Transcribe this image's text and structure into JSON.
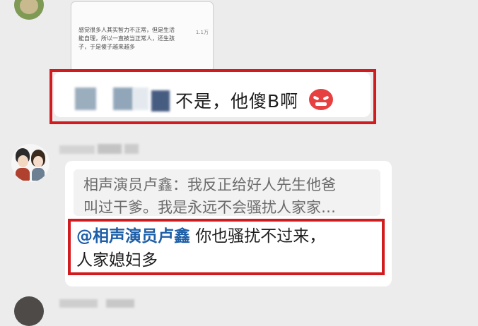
{
  "image_card": {
    "lines": [
      "感觉很多人其实智力不正常，但是生活",
      "能自理，所以一直被当正常人，还生孩",
      "子，于是傻子越来越多"
    ],
    "meta": "1.1万"
  },
  "message_1": {
    "text": "不是，他傻B啊",
    "emoji": "angry-face-icon"
  },
  "message_2": {
    "quote_lines": [
      "相声演员卢鑫：我反正给好人先生他爸",
      "叫过干爹。我是永远不会骚扰人家家…"
    ],
    "mention": "@相声演员卢鑫",
    "reply_line_1": " 你也骚扰不过来，",
    "reply_line_2": "人家媳妇多"
  },
  "colors": {
    "highlight_red": "#d21b1f",
    "mention_blue": "#1e5fa8",
    "background": "#ececec"
  }
}
